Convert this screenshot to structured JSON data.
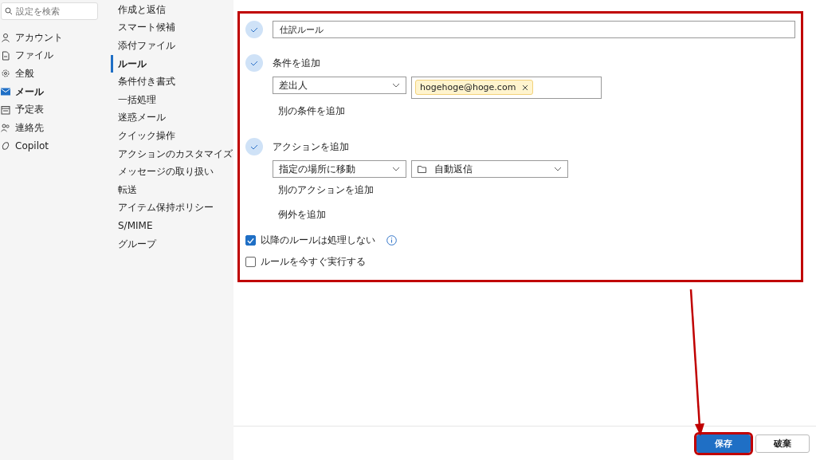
{
  "search": {
    "placeholder": "設定を検索"
  },
  "nav": [
    {
      "label": "アカウント",
      "selected": false
    },
    {
      "label": "ファイル",
      "selected": false
    },
    {
      "label": "全般",
      "selected": false
    },
    {
      "label": "メール",
      "selected": true
    },
    {
      "label": "予定表",
      "selected": false
    },
    {
      "label": "連絡先",
      "selected": false
    },
    {
      "label": "Copilot",
      "selected": false
    }
  ],
  "submenu": [
    {
      "label": "作成と返信",
      "selected": false
    },
    {
      "label": "スマート候補",
      "selected": false
    },
    {
      "label": "添付ファイル",
      "selected": false
    },
    {
      "label": "ルール",
      "selected": true
    },
    {
      "label": "条件付き書式",
      "selected": false
    },
    {
      "label": "一括処理",
      "selected": false
    },
    {
      "label": "迷惑メール",
      "selected": false
    },
    {
      "label": "クイック操作",
      "selected": false
    },
    {
      "label": "アクションのカスタマイズ",
      "selected": false
    },
    {
      "label": "メッセージの取り扱い",
      "selected": false
    },
    {
      "label": "転送",
      "selected": false
    },
    {
      "label": "アイテム保持ポリシー",
      "selected": false
    },
    {
      "label": "S/MIME",
      "selected": false
    },
    {
      "label": "グループ",
      "selected": false
    }
  ],
  "rule": {
    "highlighted": true,
    "name": "仕訳ルール",
    "condition": {
      "title": "条件を追加",
      "field": "差出人",
      "chip": "hogehoge@hoge.com",
      "add_link": "別の条件を追加"
    },
    "action": {
      "title": "アクションを追加",
      "field": "指定の場所に移動",
      "folder": "自動返信",
      "add_link": "別のアクションを追加",
      "exception_link": "例外を追加"
    },
    "options": [
      {
        "label": "以降のルールは処理しない",
        "checked": true,
        "info": true
      },
      {
        "label": "ルールを今すぐ実行する",
        "checked": false,
        "info": false
      }
    ]
  },
  "footer": {
    "save": "保存",
    "discard": "破棄",
    "save_highlighted": true,
    "arrow": true
  }
}
